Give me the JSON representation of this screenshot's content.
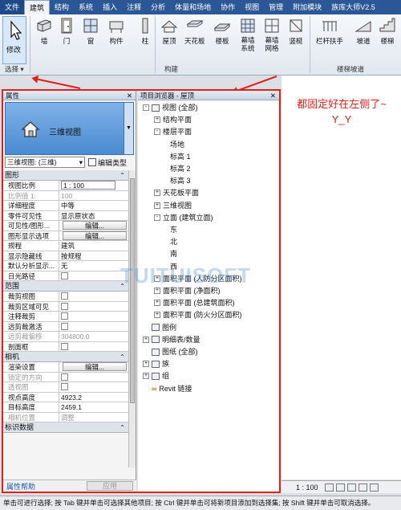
{
  "ribbon": {
    "tabs": [
      "文件",
      "建筑",
      "结构",
      "系统",
      "插入",
      "注释",
      "分析",
      "体量和场地",
      "协作",
      "视图",
      "管理",
      "附加模块",
      "族库大师V2.5"
    ],
    "active_tab": "建筑",
    "buttons": {
      "modify": "修改",
      "wall": "墙",
      "door": "门",
      "window": "窗",
      "component": "构件",
      "column": "柱",
      "roof": "屋顶",
      "ceiling": "天花板",
      "floor": "楼板",
      "curtain_system": "幕墙\n系统",
      "curtain_grid": "幕墙\n网格",
      "mullion": "竖梃",
      "railing": "栏杆扶手",
      "ramp": "坡道",
      "stair": "楼梯"
    },
    "groups": {
      "select": "选择 ▾",
      "build": "构建",
      "circulation": "楼梯坡道"
    }
  },
  "properties": {
    "title": "属性",
    "close": "✕",
    "type_name": "三维视图",
    "instance_select": "三维视图: {三维}",
    "edit_type": "编辑类型",
    "sections": [
      {
        "name": "图形",
        "rows": [
          {
            "k": "视图比例",
            "v": "1 : 100",
            "kind": "input"
          },
          {
            "k": "比例值 1:",
            "v": "100",
            "kind": "text",
            "dim": true
          },
          {
            "k": "详细程度",
            "v": "中等",
            "kind": "text"
          },
          {
            "k": "零件可见性",
            "v": "显示原状态",
            "kind": "text"
          },
          {
            "k": "可见性/图形...",
            "v": "编辑...",
            "kind": "button"
          },
          {
            "k": "图形显示选项",
            "v": "编辑...",
            "kind": "button"
          },
          {
            "k": "规程",
            "v": "建筑",
            "kind": "text"
          },
          {
            "k": "显示隐藏线",
            "v": "按规程",
            "kind": "text"
          },
          {
            "k": "默认分析显示...",
            "v": "无",
            "kind": "text"
          },
          {
            "k": "日光路径",
            "v": "",
            "kind": "check"
          }
        ]
      },
      {
        "name": "范围",
        "rows": [
          {
            "k": "裁剪视图",
            "v": "",
            "kind": "check"
          },
          {
            "k": "裁剪区域可见",
            "v": "",
            "kind": "check"
          },
          {
            "k": "注释裁剪",
            "v": "",
            "kind": "check"
          },
          {
            "k": "远剪裁激活",
            "v": "",
            "kind": "check"
          },
          {
            "k": "远剪裁偏移",
            "v": "304800.0",
            "kind": "text",
            "dim": true
          },
          {
            "k": "剖面框",
            "v": "",
            "kind": "check"
          }
        ]
      },
      {
        "name": "相机",
        "rows": [
          {
            "k": "渲染设置",
            "v": "编辑...",
            "kind": "button"
          },
          {
            "k": "锁定的方向",
            "v": "",
            "kind": "check",
            "dim": true
          },
          {
            "k": "透视图",
            "v": "",
            "kind": "check",
            "dim": true
          },
          {
            "k": "视点高度",
            "v": "4923.2",
            "kind": "text"
          },
          {
            "k": "目标高度",
            "v": "2459.1",
            "kind": "text"
          },
          {
            "k": "相机位置",
            "v": "调整",
            "kind": "text",
            "dim": true
          }
        ]
      },
      {
        "name": "标识数据",
        "rows": []
      }
    ],
    "help": "属性帮助",
    "apply": "应用"
  },
  "browser": {
    "title": "项目浏览器 - 屋顶",
    "close": "✕",
    "nodes": [
      {
        "label": "视图 (全部)",
        "level": 0,
        "pm": "-",
        "icon": true
      },
      {
        "label": "结构平面",
        "level": 1,
        "pm": "+"
      },
      {
        "label": "楼层平面",
        "level": 1,
        "pm": "-"
      },
      {
        "label": "场地",
        "level": 2
      },
      {
        "label": "标高 1",
        "level": 2
      },
      {
        "label": "标高 2",
        "level": 2
      },
      {
        "label": "标高 3",
        "level": 2
      },
      {
        "label": "天花板平面",
        "level": 1,
        "pm": "+"
      },
      {
        "label": "三维视图",
        "level": 1,
        "pm": "+"
      },
      {
        "label": "立面 (建筑立面)",
        "level": 1,
        "pm": "-"
      },
      {
        "label": "东",
        "level": 2
      },
      {
        "label": "北",
        "level": 2
      },
      {
        "label": "南",
        "level": 2
      },
      {
        "label": "西",
        "level": 2
      },
      {
        "label": "面积平面 (人防分区面积)",
        "level": 1,
        "pm": "+"
      },
      {
        "label": "面积平面 (净面积)",
        "level": 1,
        "pm": "+"
      },
      {
        "label": "面积平面 (总建筑面积)",
        "level": 1,
        "pm": "+"
      },
      {
        "label": "面积平面 (防火分区面积)",
        "level": 1,
        "pm": "+"
      },
      {
        "label": "图例",
        "level": 0,
        "icon": true
      },
      {
        "label": "明细表/数量",
        "level": 0,
        "pm": "+",
        "icon": true
      },
      {
        "label": "图纸 (全部)",
        "level": 0,
        "icon": true
      },
      {
        "label": "族",
        "level": 0,
        "pm": "+",
        "icon": true
      },
      {
        "label": "组",
        "level": 0,
        "pm": "+",
        "icon": true
      },
      {
        "label": "Revit 链接",
        "level": 0,
        "link": true
      }
    ]
  },
  "annotation": "都固定好在左侧了~\nY_Y",
  "watermark": "TUITUISOFT",
  "viewbar": {
    "scale": "1 : 100"
  },
  "status": "单击可进行选择; 按 Tab 键并单击可选择其他项目; 按 Ctrl 键并单击可将新项目添加到选择集; 按 Shift 键并单击可取消选择。",
  "colors": {
    "accent": "#2b5797",
    "annotation_red": "#e0201a",
    "type_selector": "#4a8ad0"
  }
}
